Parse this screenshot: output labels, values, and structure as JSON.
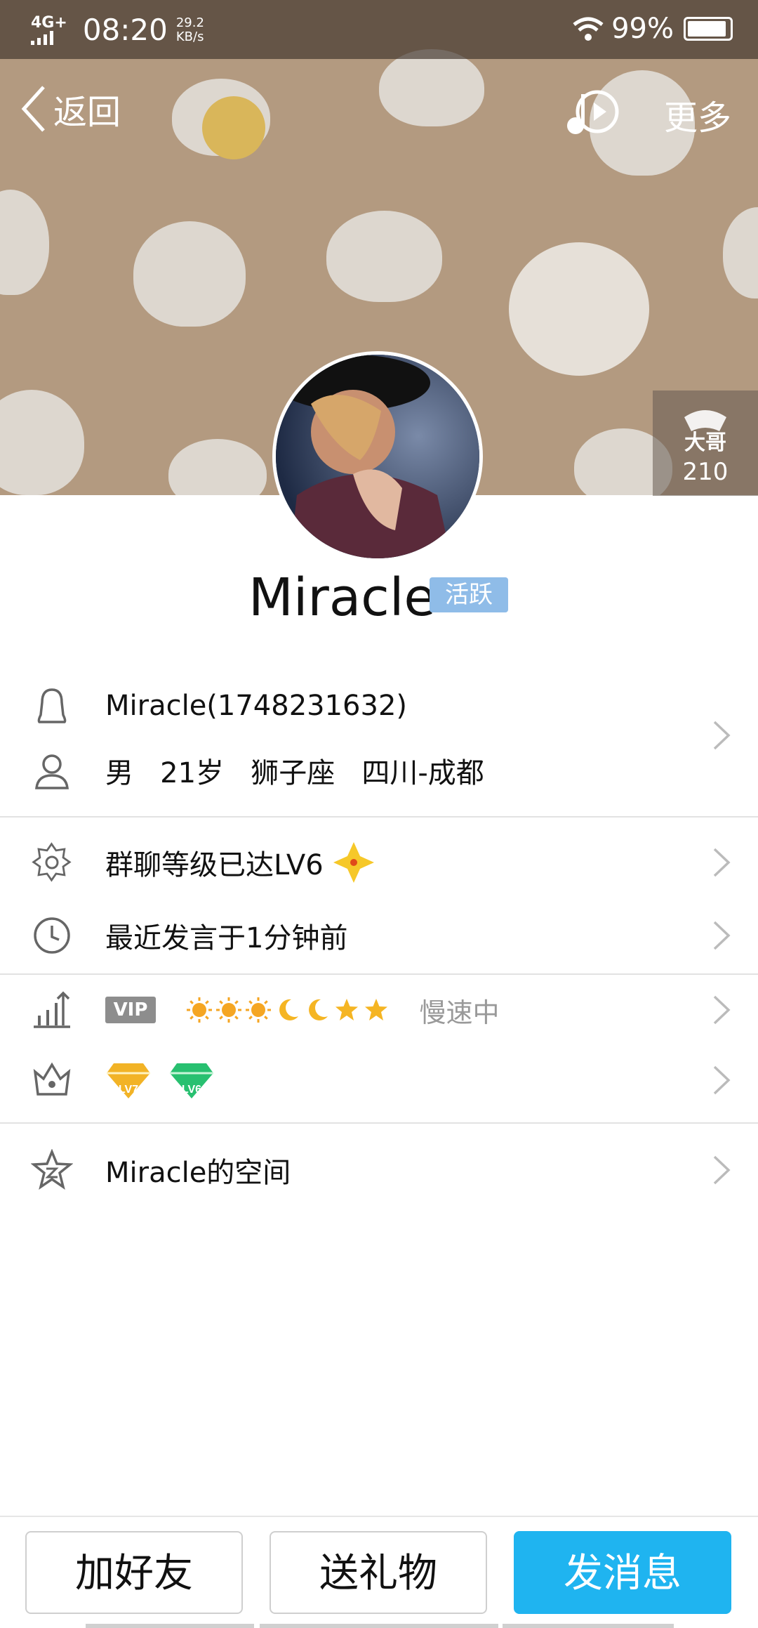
{
  "status_bar": {
    "network": "4G+",
    "time": "08:20",
    "speed_value": "29.2",
    "speed_unit": "KB/s",
    "battery_percent": "99%",
    "battery_level": 0.99
  },
  "nav": {
    "back_label": "返回",
    "more_label": "更多"
  },
  "cover_badge": {
    "label": "大哥",
    "count": "210"
  },
  "profile": {
    "name": "Miracle",
    "status_tag": "活跃"
  },
  "info": {
    "qq_line": "Miracle(1748231632)",
    "gender": "男",
    "age": "21岁",
    "zodiac": "狮子座",
    "location": "四川-成都"
  },
  "group": {
    "level_text": "群聊等级已达LV6",
    "last_speak": "最近发言于1分钟前"
  },
  "vip": {
    "tag": "VIP",
    "speed_status": "慢速中",
    "level_icons": [
      "sun-icon",
      "sun-icon",
      "sun-icon",
      "moon-icon",
      "moon-icon",
      "star-icon",
      "star-icon"
    ]
  },
  "badges": {
    "gold_label": "LV7",
    "green_label": "LV6"
  },
  "space": {
    "label": "Miracle的空间"
  },
  "actions": {
    "add_friend": "加好友",
    "send_gift": "送礼物",
    "send_message": "发消息"
  },
  "colors": {
    "cover_bg": "#b39a80",
    "primary_button": "#1fb4f0",
    "active_tag": "#8fbce8"
  }
}
